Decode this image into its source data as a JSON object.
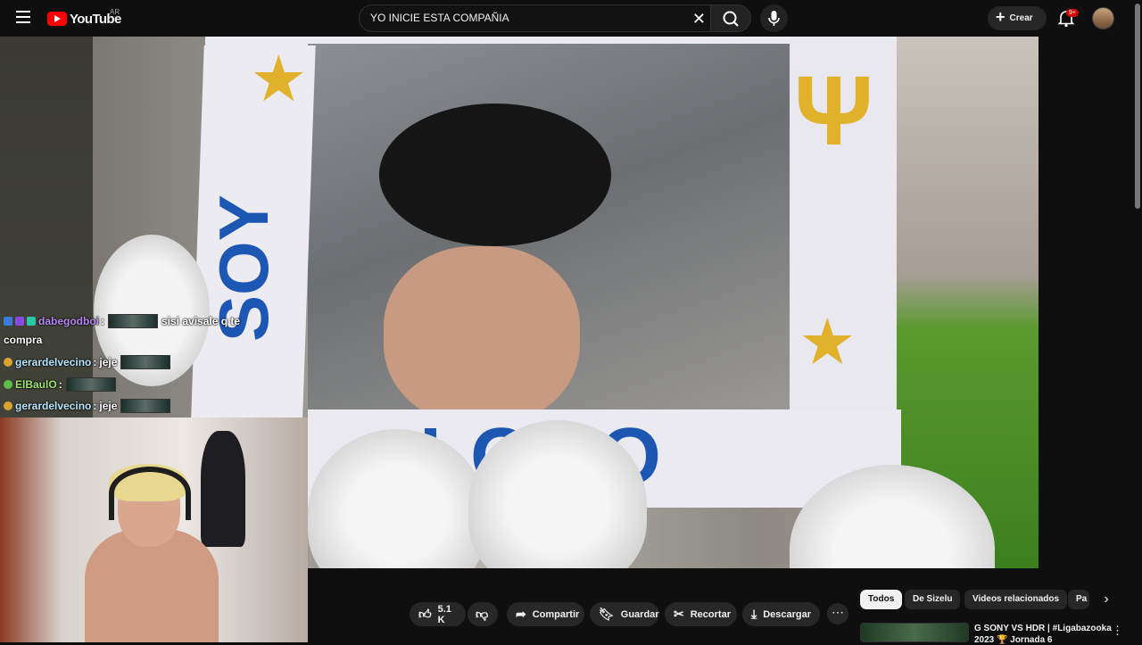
{
  "header": {
    "logo_text": "YouTube",
    "country_code": "AR",
    "search_query": "YO INICIE ESTA COMPAÑIA",
    "create_label": "Crear",
    "notification_badge": "9+"
  },
  "video": {
    "sign_word_vertical": "SOY",
    "sign_word_bottom": "LOGO"
  },
  "chat": [
    {
      "user": "dabegodboi",
      "sep": ":",
      "message": "sisi avisale q te",
      "continuation": "compra",
      "color": "#b787f5"
    },
    {
      "user": "gerardelvecino",
      "sep": ":",
      "message": "jeje",
      "color": "#b8e6ff"
    },
    {
      "user": "ElBaulO",
      "sep": ":",
      "message": "",
      "color": "#9ee36f"
    },
    {
      "user": "gerardelvecino",
      "sep": ":",
      "message": "jeje",
      "color": "#b8e6ff"
    }
  ],
  "actions": {
    "likes": "5.1 K",
    "share": "Compartir",
    "save": "Guardar",
    "clip": "Recortar",
    "download": "Descargar"
  },
  "chips": [
    "Todos",
    "De Sizelu",
    "Videos relacionados",
    "Pa"
  ],
  "recommended": {
    "title_line1": "G SONY VS HDR | #Ligabazooka",
    "title_line2": "2023 🏆 Jornada 6"
  }
}
